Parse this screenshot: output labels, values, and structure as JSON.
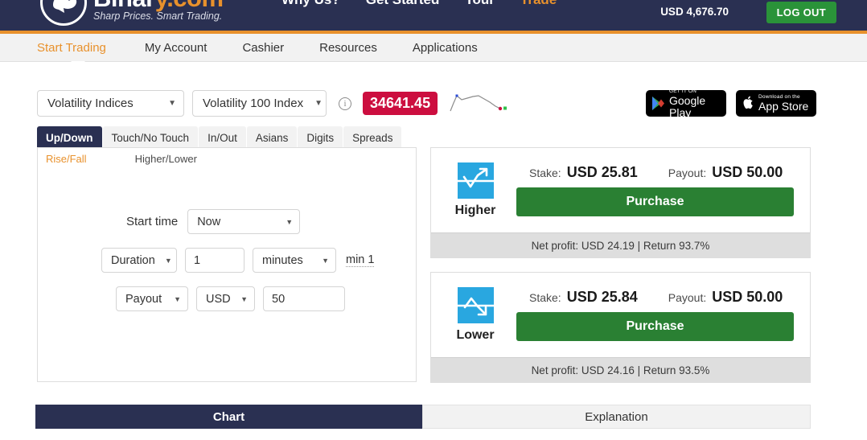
{
  "header": {
    "logo": {
      "name_white": "Binar",
      "name_orange": "y.com",
      "tagline": "Sharp Prices. Smart Trading.",
      "mark_icon": "bird-logo-icon"
    },
    "top_nav": [
      {
        "label": "Why Us?",
        "active": false
      },
      {
        "label": "Get Started",
        "active": false
      },
      {
        "label": "Tour",
        "active": false
      },
      {
        "label": "Trade",
        "active": true
      }
    ],
    "balance": "USD 4,676.70",
    "logout_label": "LOG OUT",
    "logout_color": "#2a9339",
    "accent_color": "#e8912c",
    "bg_color": "#2a3052"
  },
  "subnav": {
    "items": [
      {
        "label": "Start Trading",
        "active": true
      },
      {
        "label": "My Account",
        "active": false
      },
      {
        "label": "Cashier",
        "active": false
      },
      {
        "label": "Resources",
        "active": false
      },
      {
        "label": "Applications",
        "active": false
      }
    ]
  },
  "market": {
    "market_select": "Volatility Indices",
    "symbol_select": "Volatility 100 Index",
    "info_glyph": "i",
    "spot_price": "34641.45",
    "spot_color": "#cc0e3f",
    "sparkline_icon": "price-sparkline-icon"
  },
  "store_badges": [
    {
      "sub": "GET IT ON",
      "main": "Google Play",
      "icon": "google-play-icon"
    },
    {
      "sub": "Download on the",
      "main": "App Store",
      "icon": "apple-icon"
    }
  ],
  "contract_tabs": [
    {
      "label": "Up/Down",
      "active": true
    },
    {
      "label": "Touch/No Touch",
      "active": false
    },
    {
      "label": "In/Out",
      "active": false
    },
    {
      "label": "Asians",
      "active": false
    },
    {
      "label": "Digits",
      "active": false
    },
    {
      "label": "Spreads",
      "active": false
    }
  ],
  "form": {
    "subtabs": [
      {
        "label": "Rise/Fall",
        "active": true
      },
      {
        "label": "Higher/Lower",
        "active": false
      }
    ],
    "start_time_label": "Start time",
    "start_time_value": "Now",
    "duration_mode": "Duration",
    "duration_value": "1",
    "duration_unit": "minutes",
    "duration_min_note": "min 1",
    "basis_mode": "Payout",
    "currency": "USD",
    "amount_value": "50"
  },
  "trade_cards": [
    {
      "direction": "Higher",
      "icon": "arrow-up-trend-icon",
      "stake_label": "Stake:",
      "stake_value": "USD 25.81",
      "payout_label": "Payout:",
      "payout_value": "USD 50.00",
      "purchase_label": "Purchase",
      "footer": "Net profit: USD 24.19 | Return 93.7%"
    },
    {
      "direction": "Lower",
      "icon": "arrow-down-trend-icon",
      "stake_label": "Stake:",
      "stake_value": "USD 25.84",
      "payout_label": "Payout:",
      "payout_value": "USD 50.00",
      "purchase_label": "Purchase",
      "footer": "Net profit: USD 24.16 | Return 93.5%"
    }
  ],
  "bottom_tabs": [
    {
      "label": "Chart",
      "active": true
    },
    {
      "label": "Explanation",
      "active": false
    }
  ]
}
